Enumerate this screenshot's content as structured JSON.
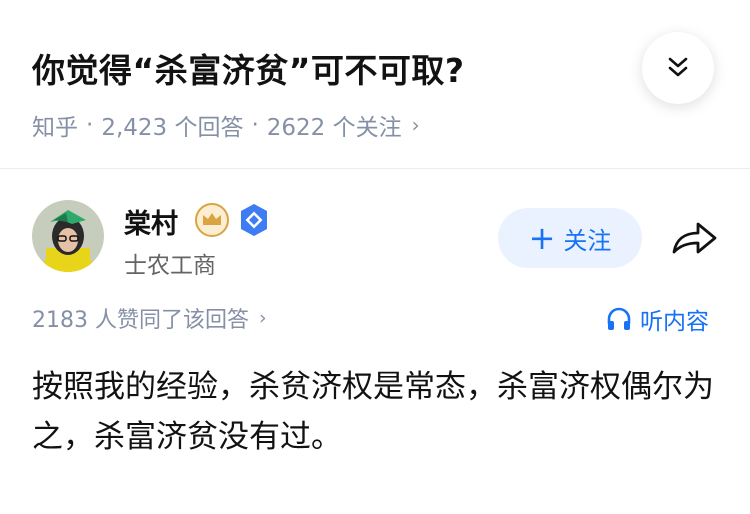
{
  "question": {
    "title": "你觉得“杀富济贫”可不可取?",
    "source": "知乎",
    "answers_count": "2,423 个回答",
    "followers_count": "2622 个关注"
  },
  "author": {
    "name": "棠村",
    "bio": "士农工商",
    "follow_label": "关注",
    "follow_plus": "+"
  },
  "answer": {
    "votes_text": "2183 人赞同了该回答",
    "listen_label": "听内容",
    "content": "按照我的经验，杀贫济权是常态，杀富济权偶尔为之，杀富济贫没有过。"
  },
  "colors": {
    "accent": "#1772f6",
    "follow_bg": "#ebf2ff",
    "meta_gray": "#8590a6",
    "crown_gold": "#d9a441"
  },
  "icons": {
    "collapse": "double-chevron-down-icon",
    "share": "share-arrow-icon",
    "listen": "headphones-icon",
    "crown_badge": "crown-badge-icon",
    "verified_badge": "verified-badge-icon"
  }
}
